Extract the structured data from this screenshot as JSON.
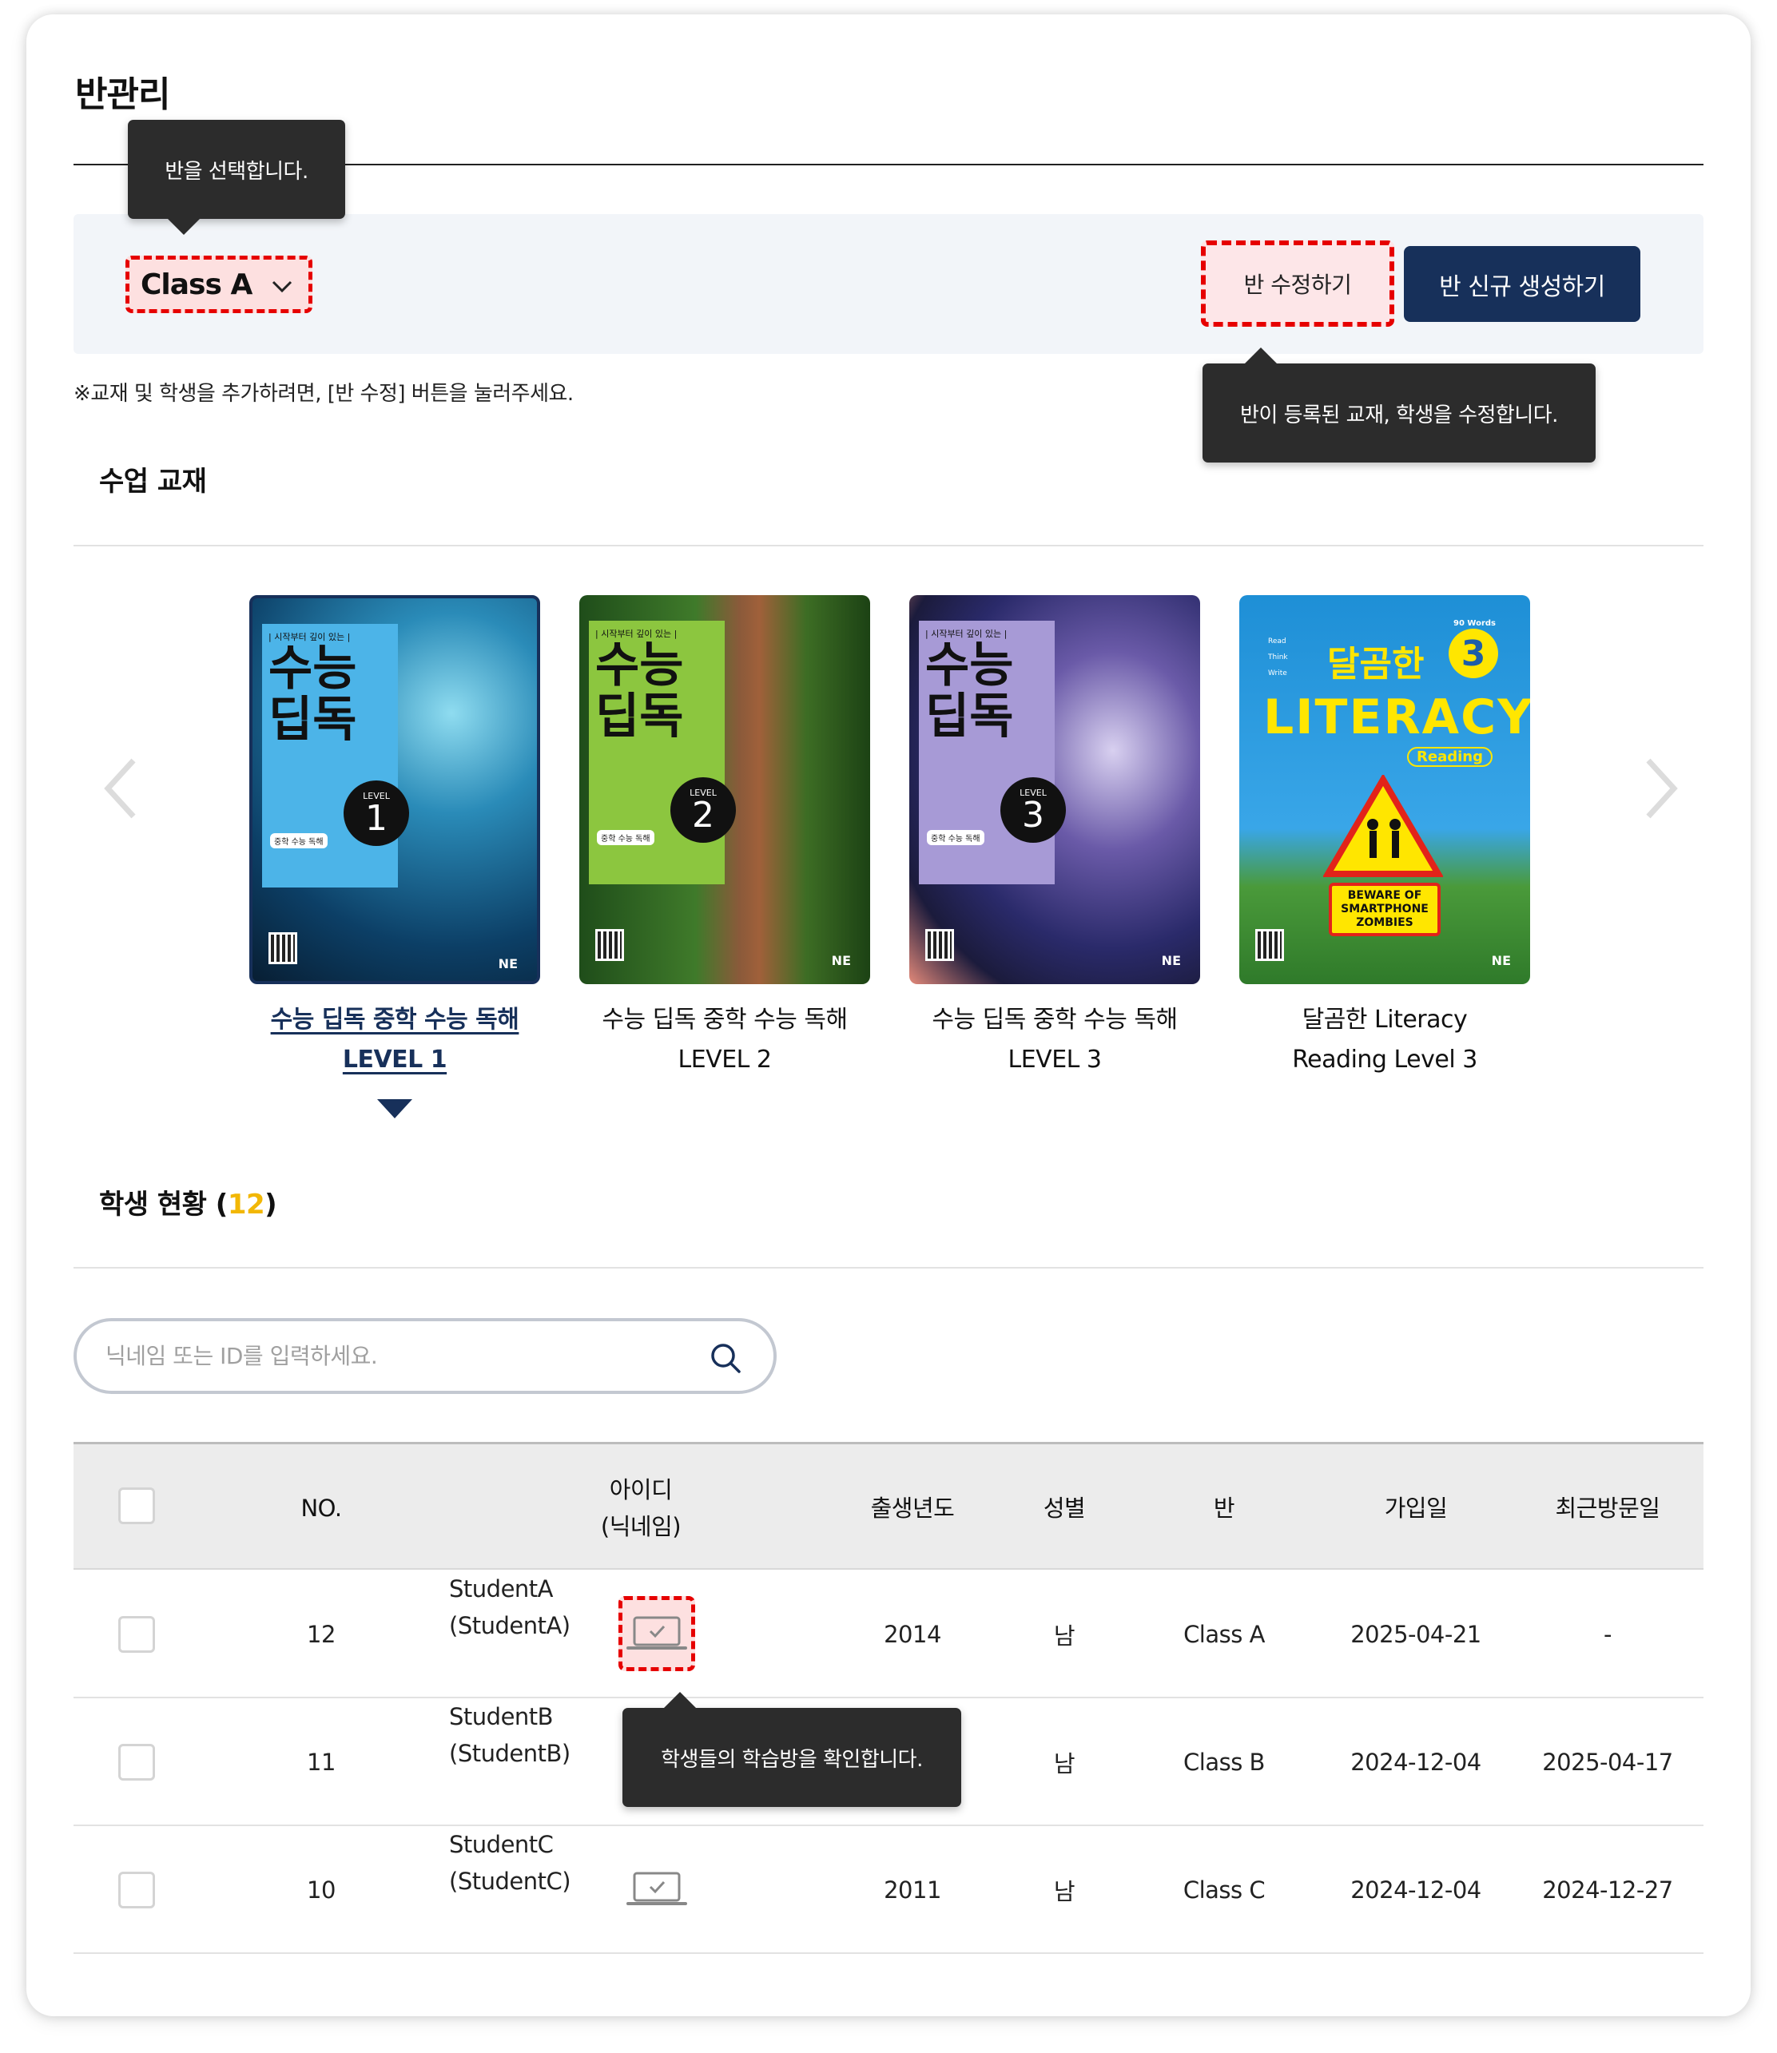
{
  "page": {
    "title": "반관리"
  },
  "class_bar": {
    "selected_class": "Class A",
    "edit_button": "반 수정하기",
    "new_button": "반 신규 생성하기"
  },
  "tooltips": {
    "select_class": "반을 선택합니다.",
    "edit_class": "반이 등록된 교재, 학생을 수정합니다.",
    "study_room": "학생들의 학습방을 확인합니다."
  },
  "notice": "※교재 및 학생을 추가하려면, [반 수정] 버튼을 눌러주세요.",
  "textbooks": {
    "section_title": "수업 교재",
    "items": [
      {
        "line1": "수능 딥독 중학 수능 독해",
        "line2": "LEVEL 1",
        "cover_title_1": "수능",
        "cover_title_2": "딥독",
        "level_label": "LEVEL",
        "level_num": "1",
        "tag": "| 시작부터 깊이 있는 |",
        "badge": "중학 수능 독해",
        "publisher": "NE",
        "selected": true
      },
      {
        "line1": "수능 딥독 중학 수능 독해",
        "line2": "LEVEL 2",
        "cover_title_1": "수능",
        "cover_title_2": "딥독",
        "level_label": "LEVEL",
        "level_num": "2",
        "tag": "| 시작부터 깊이 있는 |",
        "badge": "중학 수능 독해",
        "publisher": "NE",
        "selected": false
      },
      {
        "line1": "수능 딥독 중학 수능 독해",
        "line2": "LEVEL 3",
        "cover_title_1": "수능",
        "cover_title_2": "딥독",
        "level_label": "LEVEL",
        "level_num": "3",
        "tag": "| 시작부터 깊이 있는 |",
        "badge": "중학 수능 독해",
        "publisher": "NE",
        "selected": false
      },
      {
        "line1": "달곰한 Literacy",
        "line2": "Reading Level 3",
        "cover_title_1": "달곰한",
        "cover_title_2": "LITERACY",
        "reading": "Reading",
        "level_num": "3",
        "sign": "BEWARE OF SMARTPHONE ZOMBIES",
        "words": "90 Words",
        "steps": [
          "Read",
          "Think",
          "Write"
        ],
        "publisher": "NE",
        "selected": false
      }
    ]
  },
  "students": {
    "section_title": "학생 현황 (",
    "count": "12",
    "section_title_end": ")",
    "search_placeholder": "닉네임 또는 ID를 입력하세요.",
    "columns": {
      "no": "NO.",
      "id_line1": "아이디",
      "id_line2": "(닉네임)",
      "birth": "출생년도",
      "gender": "성별",
      "class": "반",
      "joined": "가입일",
      "last_visit": "최근방문일"
    },
    "rows": [
      {
        "no": "12",
        "id": "StudentA",
        "nick": "(StudentA)",
        "birth": "2014",
        "gender": "남",
        "class": "Class A",
        "joined": "2025-04-21",
        "last_visit": "-"
      },
      {
        "no": "11",
        "id": "StudentB",
        "nick": "(StudentB)",
        "birth": "",
        "gender": "남",
        "class": "Class B",
        "joined": "2024-12-04",
        "last_visit": "2025-04-17"
      },
      {
        "no": "10",
        "id": "StudentC",
        "nick": "(StudentC)",
        "birth": "2011",
        "gender": "남",
        "class": "Class C",
        "joined": "2024-12-04",
        "last_visit": "2024-12-27"
      }
    ]
  },
  "colors": {
    "navy": "#17305a",
    "highlight_red": "#e60000",
    "count_yellow": "#f2b705",
    "tooltip_bg": "#2c2c2c"
  }
}
